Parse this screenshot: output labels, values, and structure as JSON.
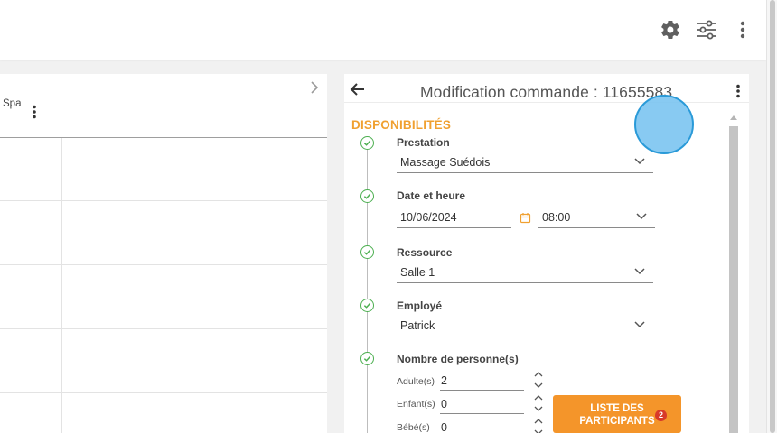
{
  "toolbar": {
    "icons": [
      "gear-icon",
      "tune-icon",
      "more-vert-icon"
    ]
  },
  "left_panel": {
    "column_header": "Spa"
  },
  "order_panel": {
    "title": "Modification commande : 11655583",
    "section": "DISPONIBILITÉS",
    "prestation": {
      "label": "Prestation",
      "value": "Massage Suédois"
    },
    "date_time": {
      "label": "Date et heure",
      "date": "10/06/2024",
      "time": "08:00"
    },
    "resource": {
      "label": "Ressource",
      "value": "Salle 1"
    },
    "employee": {
      "label": "Employé",
      "value": "Patrick"
    },
    "persons": {
      "label": "Nombre de personne(s)",
      "adults_label": "Adulte(s)",
      "adults": "2",
      "children_label": "Enfant(s)",
      "children": "0",
      "babies_label": "Bébé(s)",
      "babies": "0"
    },
    "participants_button": {
      "label_line1": "LISTE DES",
      "label_line2": "PARTICIPANTS",
      "badge": "2"
    }
  },
  "colors": {
    "accent_orange": "#f4952a",
    "section_orange": "#f0a030",
    "check_green": "#4caf50",
    "badge_red": "#d83a2a",
    "touch_indicator": "#78c3f0"
  }
}
